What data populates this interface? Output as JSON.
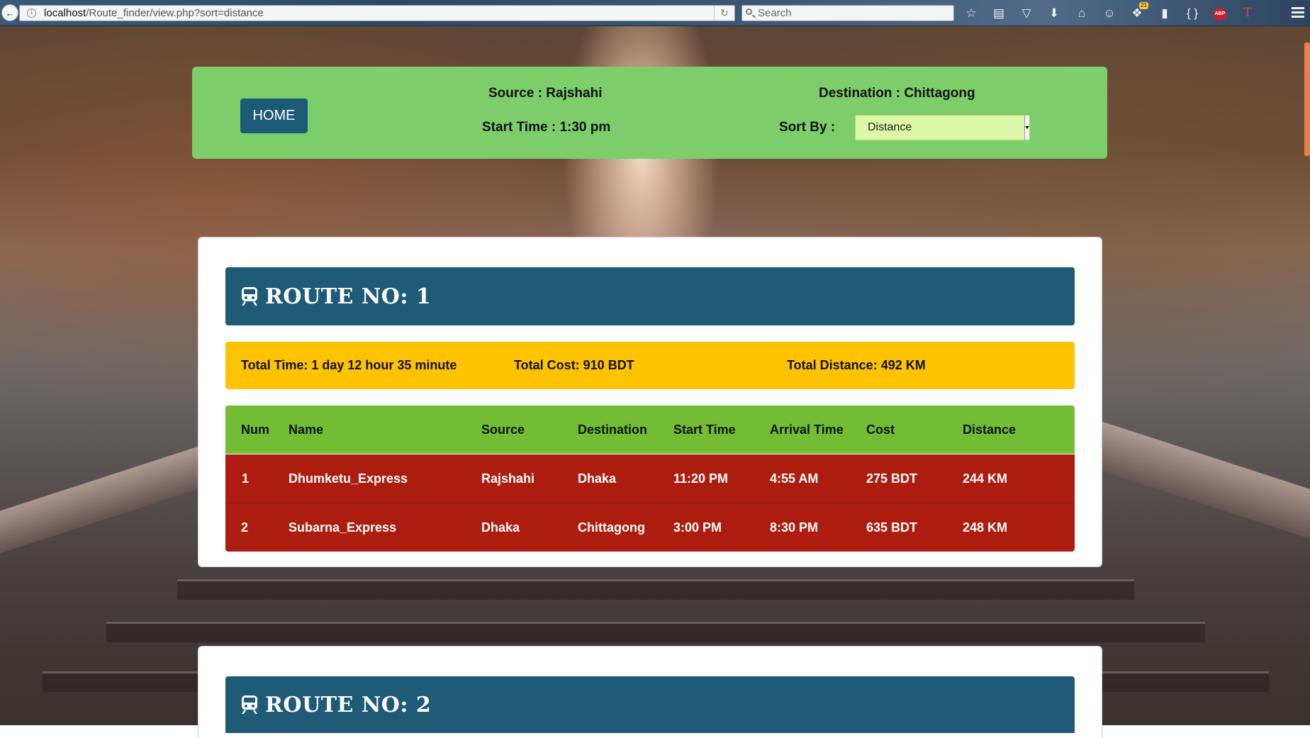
{
  "browser": {
    "url_host": "localhost",
    "url_path": "/Route_finder/view.php?sort=distance",
    "search_placeholder": "Search",
    "downloads_badge": "21",
    "abp_label": "ABP",
    "devtools_label": "{ }"
  },
  "header": {
    "home_label": "HOME",
    "source_text": "Source : Rajshahi",
    "destination_text": "Destination : Chittagong",
    "start_time_text": "Start Time : 1:30 pm",
    "sort_label": "Sort By :",
    "sort_value": "Distance"
  },
  "table_headers": [
    "Num",
    "Name",
    "Source",
    "Destination",
    "Start Time",
    "Arrival Time",
    "Cost",
    "Distance"
  ],
  "routes": [
    {
      "title": "ROUTE NO: 1",
      "total_time": "Total Time: 1 day 12 hour 35 minute",
      "total_cost": "Total Cost: 910 BDT",
      "total_distance": "Total Distance: 492 KM",
      "rows": [
        [
          "1",
          "Dhumketu_Express",
          "Rajshahi",
          "Dhaka",
          "11:20 PM",
          "4:55 AM",
          "275 BDT",
          "244 KM"
        ],
        [
          "2",
          "Subarna_Express",
          "Dhaka",
          "Chittagong",
          "3:00 PM",
          "8:30 PM",
          "635 BDT",
          "248 KM"
        ]
      ]
    },
    {
      "title": "ROUTE NO: 2"
    }
  ],
  "colors": {
    "header_panel": "#7dcd6a",
    "home_button": "#1d5a78",
    "title_bar": "#1f5b76",
    "summary_bar": "#fdc200",
    "table_head": "#72bd33",
    "table_row": "#ac1d10"
  }
}
